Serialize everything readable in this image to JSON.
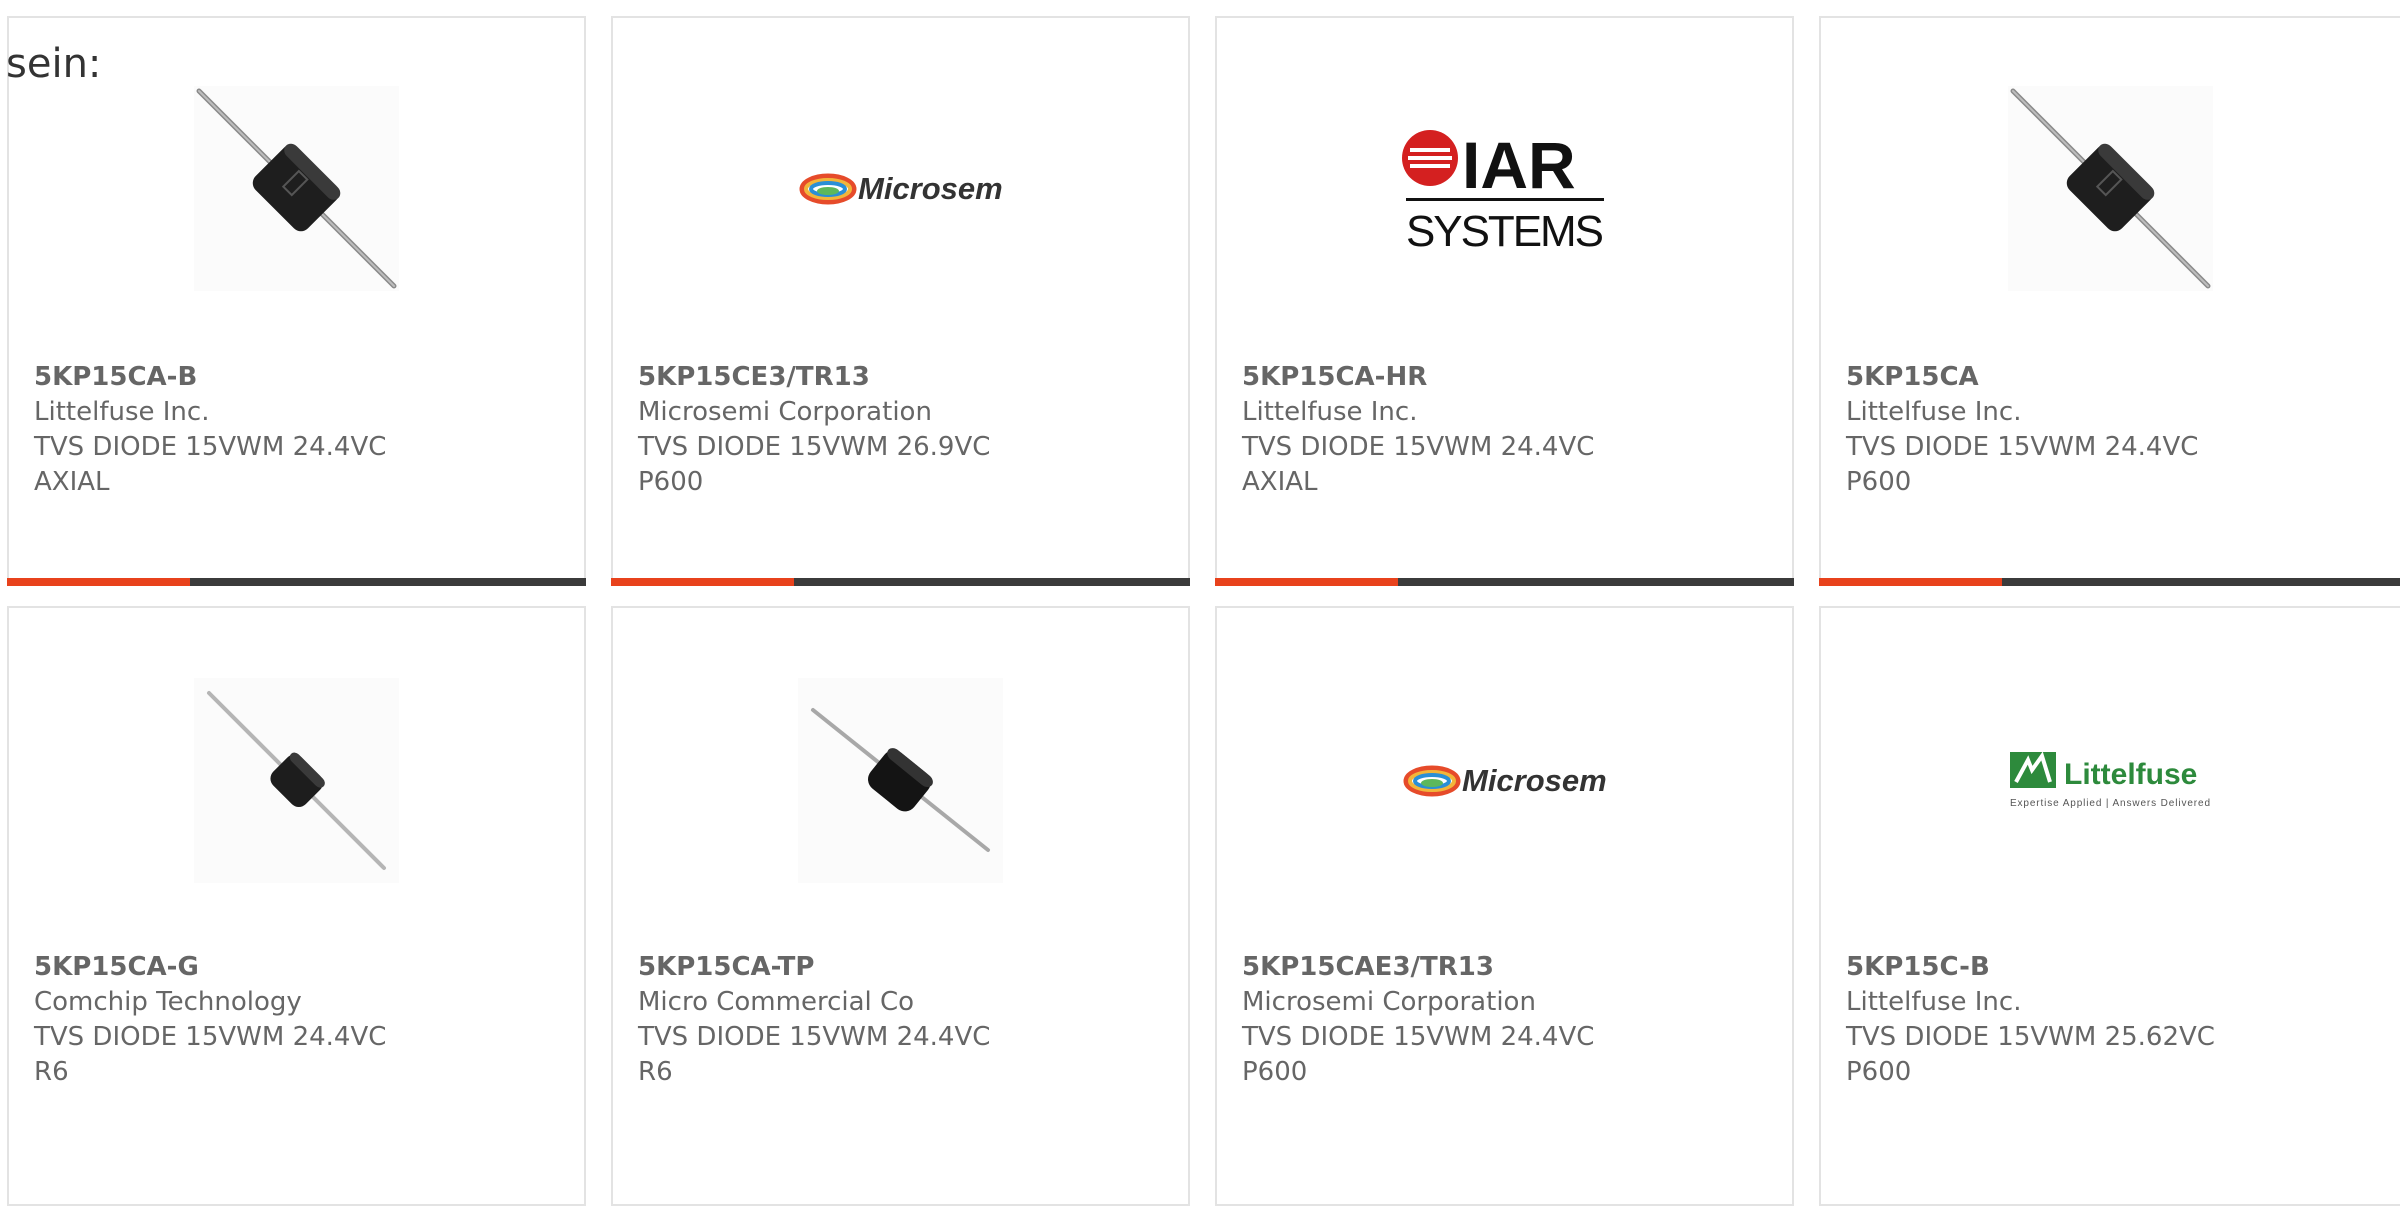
{
  "top_label": "sein:",
  "colors": {
    "accent_bar": "#e8421c",
    "dark_bar": "#3b3b3b",
    "text": "#666666",
    "card_border": "#e3e3e3"
  },
  "products": [
    {
      "part": "5KP15CA-B",
      "manufacturer": "Littelfuse Inc.",
      "description": "TVS DIODE 15VWM 24.4VC AXIAL",
      "image": "axial-diode-large",
      "has_bar": true
    },
    {
      "part": "5KP15CE3/TR13",
      "manufacturer": "Microsemi Corporation",
      "description": "TVS DIODE 15VWM 26.9VC P600",
      "image": "microsemi-logo",
      "logo_text": "Microsemi",
      "has_bar": true
    },
    {
      "part": "5KP15CA-HR",
      "manufacturer": "Littelfuse Inc.",
      "description": "TVS DIODE 15VWM 24.4VC AXIAL",
      "image": "iar-systems-logo",
      "logo_text_top": "IAR",
      "logo_text_bottom": "SYSTEMS",
      "has_bar": true
    },
    {
      "part": "5KP15CA",
      "manufacturer": "Littelfuse Inc.",
      "description": "TVS DIODE 15VWM 24.4VC P600",
      "image": "axial-diode-large",
      "has_bar": true
    },
    {
      "part": "5KP15CA-G",
      "manufacturer": "Comchip Technology",
      "description": "TVS DIODE 15VWM 24.4VC R6",
      "image": "axial-diode-small",
      "has_bar": false
    },
    {
      "part": "5KP15CA-TP",
      "manufacturer": "Micro Commercial Co",
      "description": "TVS DIODE 15VWM 24.4VC R6",
      "image": "axial-diode-small",
      "has_bar": false
    },
    {
      "part": "5KP15CAE3/TR13",
      "manufacturer": "Microsemi Corporation",
      "description": "TVS DIODE 15VWM 24.4VC P600",
      "image": "microsemi-logo",
      "logo_text": "Microsemi",
      "has_bar": false
    },
    {
      "part": "5KP15C-B",
      "manufacturer": "Littelfuse Inc.",
      "description": "TVS DIODE 15VWM 25.62VC P600",
      "image": "littelfuse-logo",
      "logo_text": "Littelfuse",
      "logo_tagline": "Expertise Applied | Answers Delivered",
      "has_bar": false
    }
  ]
}
